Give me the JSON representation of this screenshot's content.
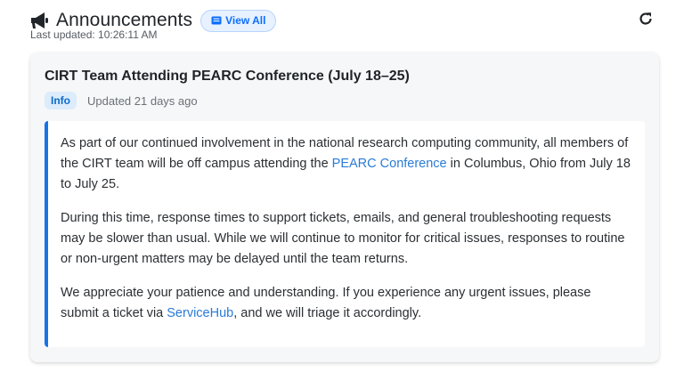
{
  "header": {
    "title": "Announcements",
    "view_all_label": "View All",
    "last_updated": "Last updated: 10:26:11 AM"
  },
  "announcement": {
    "title": "CIRT Team Attending PEARC Conference (July 18–25)",
    "badge": "Info",
    "updated": "Updated 21 days ago",
    "p1_before": "As part of our continued involvement in the national research computing community, all members of the CIRT team will be off campus attending the ",
    "p1_link": "PEARC Conference",
    "p1_after": " in Columbus, Ohio from July 18 to July 25.",
    "p2": "During this time, response times to support tickets, emails, and general troubleshooting requests may be slower than usual. While we will continue to monitor for critical issues, responses to routine or non-urgent matters may be delayed until the team returns.",
    "p3_before": "We appreciate your patience and understanding. If you experience any urgent issues, please submit a ticket via ",
    "p3_link": "ServiceHub",
    "p3_after": ", and we will triage it accordingly."
  },
  "icons": {
    "title_icon": "megaphone-icon",
    "view_all_icon": "newspaper-icon",
    "refresh_icon": "refresh-icon"
  },
  "colors": {
    "accent": "#1574e8",
    "badge_bg": "#dcecfb",
    "badge_text": "#0b6bcb",
    "link": "#2a7bd6"
  }
}
